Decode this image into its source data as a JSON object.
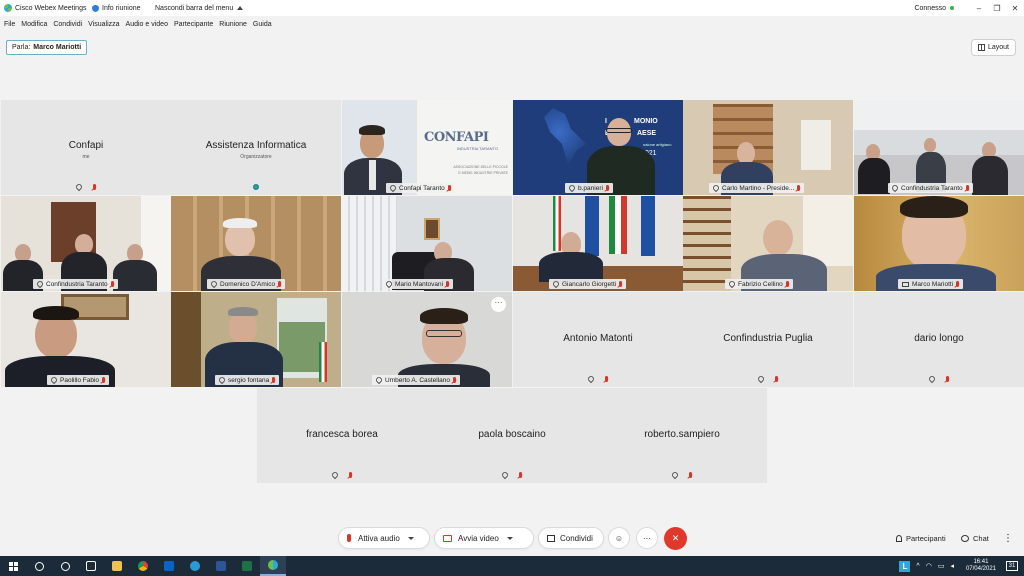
{
  "titlebar": {
    "app_name": "Cisco Webex Meetings",
    "info": "Info riunione",
    "hide_menu": "Nascondi barra del menu",
    "status": "Connesso",
    "minimize": "–",
    "restore": "❐",
    "close": "✕"
  },
  "menu": [
    "File",
    "Modifica",
    "Condividi",
    "Visualizza",
    "Audio e video",
    "Partecipante",
    "Riunione",
    "Guida"
  ],
  "speaker": {
    "label": "Parla:",
    "name": "Marco Mariotti"
  },
  "layout_label": "Layout",
  "tiles": [
    {
      "name": "Confapi",
      "role": "me",
      "video": false
    },
    {
      "name": "Assistenza Informatica",
      "role": "Organizzatore",
      "video": false
    },
    {
      "name": "Confapi Taranto",
      "video": true
    },
    {
      "name": "b.panieri",
      "video": true
    },
    {
      "name": "Carlo Martino - Preside...",
      "video": true
    },
    {
      "name": "Confindustria Taranto",
      "video": true
    },
    {
      "name": "Confindustria Taranto",
      "video": true
    },
    {
      "name": "Domenico D'Amico",
      "video": true
    },
    {
      "name": "Mario Mantovani",
      "video": true
    },
    {
      "name": "Giancarlo Giorgetti",
      "video": true
    },
    {
      "name": "Fabrizio Cellino",
      "video": true
    },
    {
      "name": "Marco Mariotti",
      "video": true
    },
    {
      "name": "Paolillo Fabio",
      "video": true
    },
    {
      "name": "sergio fontana",
      "video": true
    },
    {
      "name": "Umberto A. Castellano",
      "video": true
    },
    {
      "name": "Antonio Matonti",
      "video": false
    },
    {
      "name": "Confindustria Puglia",
      "video": false
    },
    {
      "name": "dario longo",
      "video": false
    },
    {
      "name": "francesca borea",
      "video": false
    },
    {
      "name": "paola boscaino",
      "video": false
    },
    {
      "name": "roberto.sampiero",
      "video": false
    }
  ],
  "banner_text": {
    "confapi_logo": "CONFAPI",
    "confapi_sub": "INDUSTRIA TARANTO",
    "confapi_assoc_1": "ASSOCIAZIONE DELLE PICCOLE",
    "confapi_assoc_2": "E MEDIE INDUSTRIE PRIVATE",
    "bp_1": "I",
    "bp_2": "E",
    "bp_3": "MONIO",
    "bp_4": "AESE",
    "bp_5": "nalone artigiano",
    "bp_6": "2021"
  },
  "more_options": "···",
  "controls": {
    "audio": "Attiva audio",
    "video": "Avvia video",
    "share": "Condividi",
    "reactions_icon": "☺",
    "more": "···",
    "end": "✕",
    "participants": "Partecipanti",
    "chat": "Chat",
    "overflow": "⋮"
  },
  "taskbar": {
    "time": "16:41",
    "date": "07/04/2021",
    "notifications": "31",
    "l_badge": "L",
    "tray_chevron": "^",
    "colors": {
      "bg": "#1c2b3a"
    }
  },
  "accent": "#23a8c2"
}
